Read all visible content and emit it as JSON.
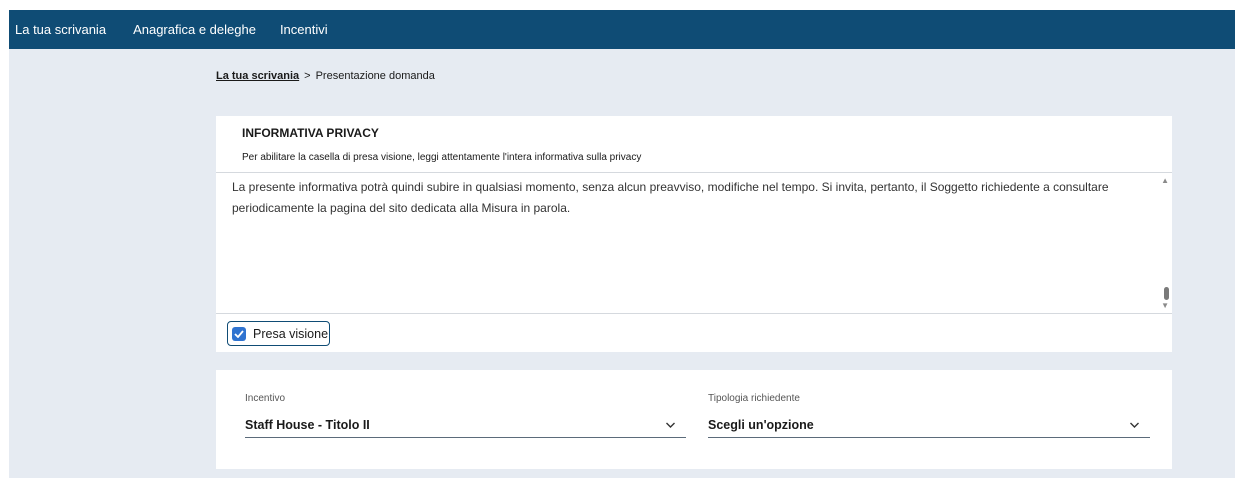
{
  "nav": {
    "items": [
      {
        "label": "La tua scrivania"
      },
      {
        "label": "Anagrafica e deleghe"
      },
      {
        "label": "Incentivi"
      }
    ]
  },
  "breadcrumb": {
    "home": "La tua scrivania",
    "separator": ">",
    "current": "Presentazione domanda"
  },
  "privacy": {
    "title": "INFORMATIVA PRIVACY",
    "subtitle": "Per abilitare la casella di presa visione, leggi attentamente l'intera informativa sulla privacy",
    "text": "La presente informativa potrà quindi subire in qualsiasi momento, senza alcun preavviso, modifiche nel tempo. Si invita, pertanto, il Soggetto richiedente a consultare periodicamente la pagina del sito dedicata alla Misura in parola.",
    "checkbox_label": "Presa visione",
    "checked": true
  },
  "form": {
    "incentivo": {
      "label": "Incentivo",
      "value": "Staff House - Titolo II"
    },
    "tipologia": {
      "label": "Tipologia richiedente",
      "value": "Scegli un'opzione"
    }
  },
  "colors": {
    "nav_bg": "#0f4c75",
    "page_bg": "#e6ebf2",
    "checkbox": "#2f73d0"
  }
}
